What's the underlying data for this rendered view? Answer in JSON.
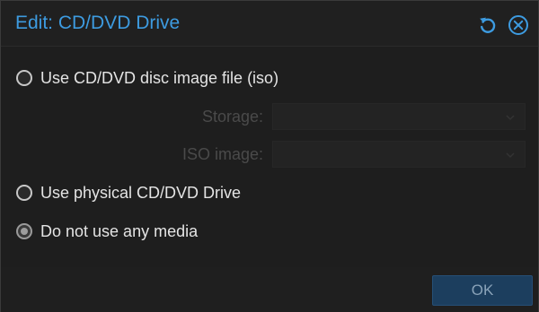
{
  "dialog": {
    "title": "Edit: CD/DVD Drive",
    "tools": {
      "reset_icon": "reset-icon",
      "close_icon": "close-icon"
    }
  },
  "options": [
    {
      "label": "Use CD/DVD disc image file (iso)",
      "checked": false
    },
    {
      "label": "Use physical CD/DVD Drive",
      "checked": false
    },
    {
      "label": "Do not use any media",
      "checked": true
    }
  ],
  "iso_fields": {
    "storage": {
      "label": "Storage:",
      "value": "",
      "disabled": true
    },
    "iso_image": {
      "label": "ISO image:",
      "value": "",
      "disabled": true
    }
  },
  "footer": {
    "ok_label": "OK"
  },
  "colors": {
    "accent": "#3d9be0",
    "background": "#202020",
    "ok_button_bg": "#1c3e5e"
  }
}
